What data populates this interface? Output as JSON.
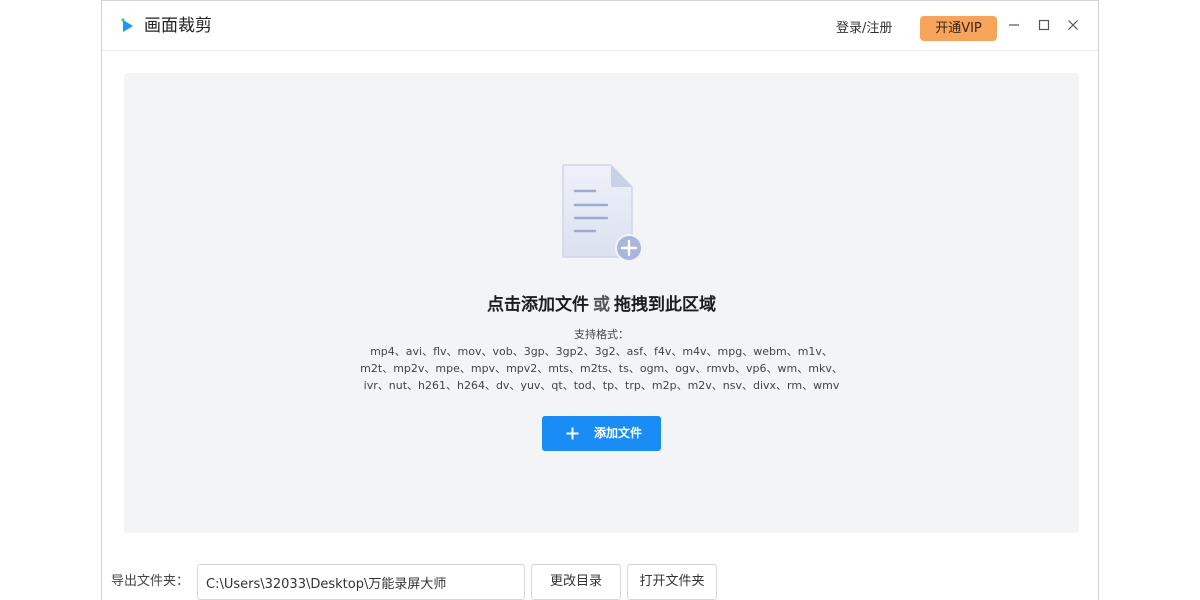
{
  "app": {
    "title": "画面裁剪",
    "logo_icon": "play-logo-icon"
  },
  "header": {
    "login_label": "登录/注册",
    "vip_label": "开通VIP",
    "vip_color": "#f6a35c"
  },
  "window_controls": [
    "minimize-icon",
    "maximize-icon",
    "close-icon"
  ],
  "dropzone": {
    "icon": "add-document-icon",
    "headline_part1": "点击添加文件",
    "headline_or": "或",
    "headline_part2": "拖拽到此区域",
    "formats_label": "支持格式：",
    "formats_lines": [
      "mp4、avi、flv、mov、vob、3gp、3gp2、3g2、asf、f4v、m4v、mpg、webm、m1v、",
      "m2t、mp2v、mpe、mpv、mpv2、mts、m2ts、ts、ogm、ogv、rmvb、vp6、wm、mkv、",
      "ivr、nut、h261、h264、dv、yuv、qt、tod、tp、trp、m2p、m2v、nsv、divx、rm、wmv"
    ],
    "add_button_label": "添加文件",
    "add_button_color": "#1a8cf5"
  },
  "export": {
    "label": "导出文件夹：",
    "path_value": "C:\\Users\\32033\\Desktop\\万能录屏大师",
    "change_dir_label": "更改目录",
    "open_folder_label": "打开文件夹"
  }
}
